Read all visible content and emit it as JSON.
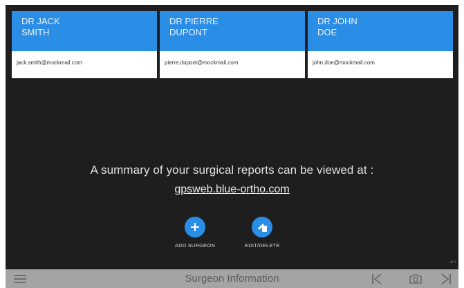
{
  "surgeons": [
    {
      "name_line1": "Dr JACK",
      "name_line2": "SMITH",
      "email": "jack.smith@mockmail.com"
    },
    {
      "name_line1": "Dr PIERRE",
      "name_line2": "DUPONT",
      "email": "pierre.dupont@mockmail.com"
    },
    {
      "name_line1": "Dr JOHN",
      "name_line2": "DOE",
      "email": "john.doe@mockmail.com"
    }
  ],
  "summary": {
    "text": "A summary of your surgical reports can be viewed at :",
    "link": "gpsweb.blue-ortho.com"
  },
  "actions": {
    "add_label": "ADD SURGEON",
    "edit_label": "EDIT/DELETE"
  },
  "version": "v1.7",
  "bottom_bar": {
    "title": "Surgeon Information",
    "icons": [
      "menu-icon",
      "previous-icon",
      "camera-icon",
      "next-icon"
    ]
  },
  "colors": {
    "accent": "#2b8ee6",
    "background": "#1e1e1e",
    "bottom_bar": "#a4a4a4"
  }
}
